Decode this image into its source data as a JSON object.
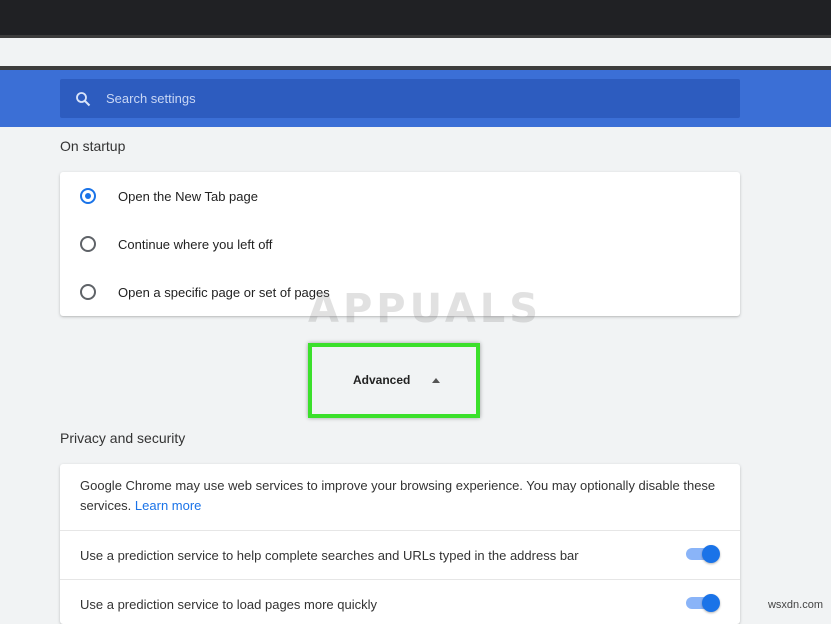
{
  "search": {
    "placeholder": "Search settings"
  },
  "startup": {
    "title": "On startup",
    "options": [
      {
        "label": "Open the New Tab page",
        "selected": true
      },
      {
        "label": "Continue where you left off",
        "selected": false
      },
      {
        "label": "Open a specific page or set of pages",
        "selected": false
      }
    ]
  },
  "watermark": "APPUALS",
  "advanced": {
    "label": "Advanced"
  },
  "privacy": {
    "title": "Privacy and security",
    "intro": "Google Chrome may use web services to improve your browsing experience. You may optionally disable these services.",
    "learn_more": "Learn more",
    "toggles": [
      {
        "label": "Use a prediction service to help complete searches and URLs typed in the address bar",
        "on": true
      },
      {
        "label": "Use a prediction service to load pages more quickly",
        "on": true
      }
    ]
  },
  "site_watermark": "wsxdn.com",
  "colors": {
    "accent": "#1a73e8",
    "header": "#3b6fd6",
    "highlight": "#3be02b"
  }
}
